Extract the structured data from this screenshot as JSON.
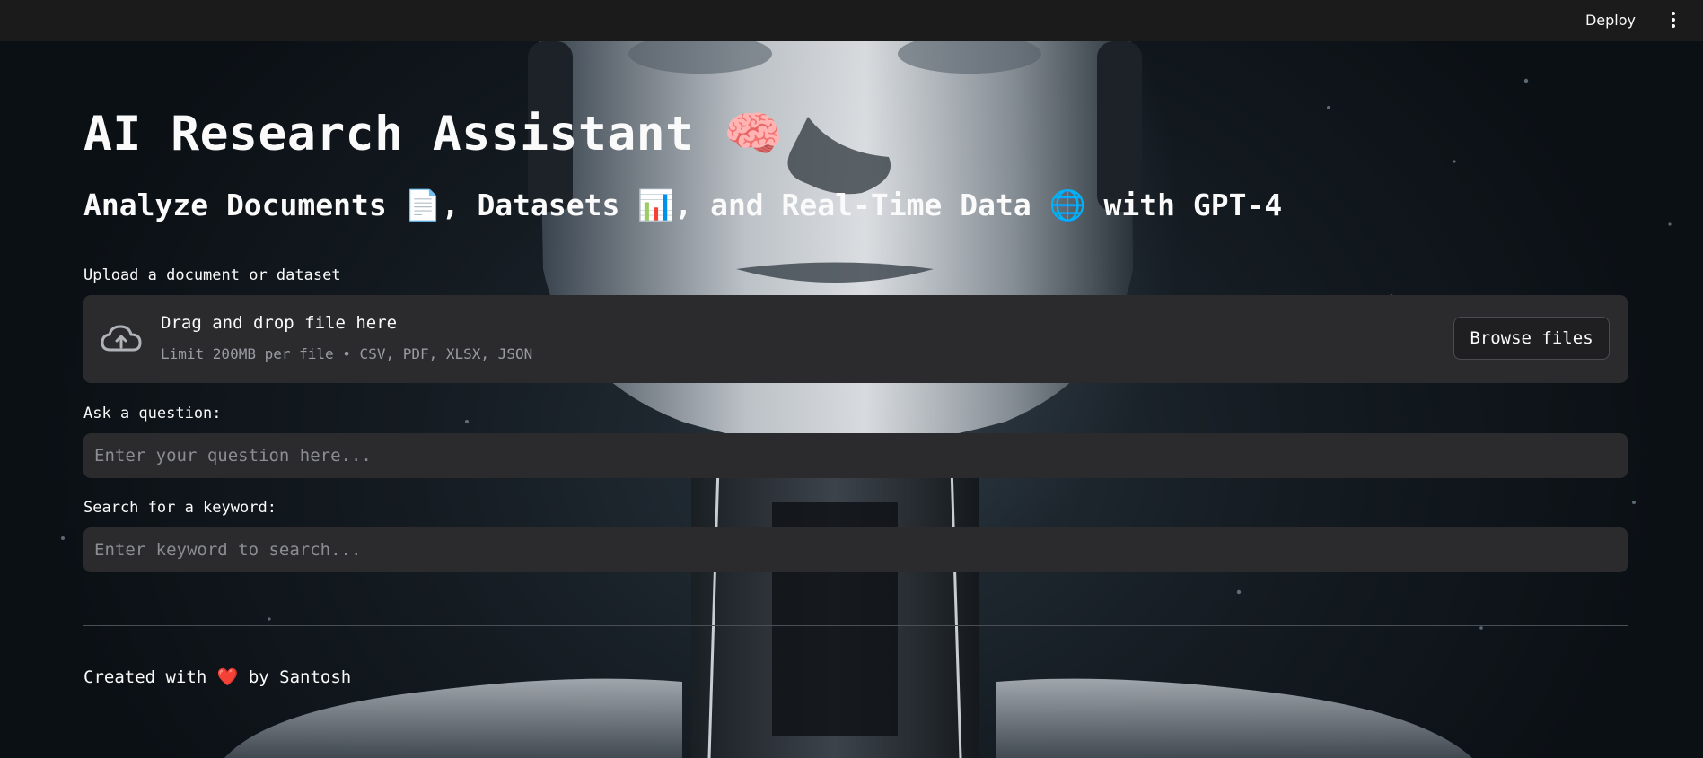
{
  "topbar": {
    "deploy_label": "Deploy",
    "menu_icon": "vertical-ellipsis-icon"
  },
  "header": {
    "title": "AI Research Assistant 🧠",
    "subtitle": "Analyze Documents 📄, Datasets 📊, and Real-Time Data 🌐 with GPT-4"
  },
  "uploader": {
    "label": "Upload a document or dataset",
    "drop_text": "Drag and drop file here",
    "limit_text": "Limit 200MB per file • CSV, PDF, XLSX, JSON",
    "browse_label": "Browse files",
    "icon": "cloud-upload-icon"
  },
  "question": {
    "label": "Ask a question:",
    "placeholder": "Enter your question here...",
    "value": ""
  },
  "keyword": {
    "label": "Search for a keyword:",
    "placeholder": "Enter keyword to search...",
    "value": ""
  },
  "footer": {
    "prefix": "Created with",
    "heart": "❤️",
    "suffix": "by Santosh"
  },
  "colors": {
    "topbar_bg": "#1b1b1c",
    "widget_bg": "#2b2b2d",
    "text": "#fafafa",
    "muted_text": "#9a9ca3",
    "heart": "#ff4b77"
  }
}
